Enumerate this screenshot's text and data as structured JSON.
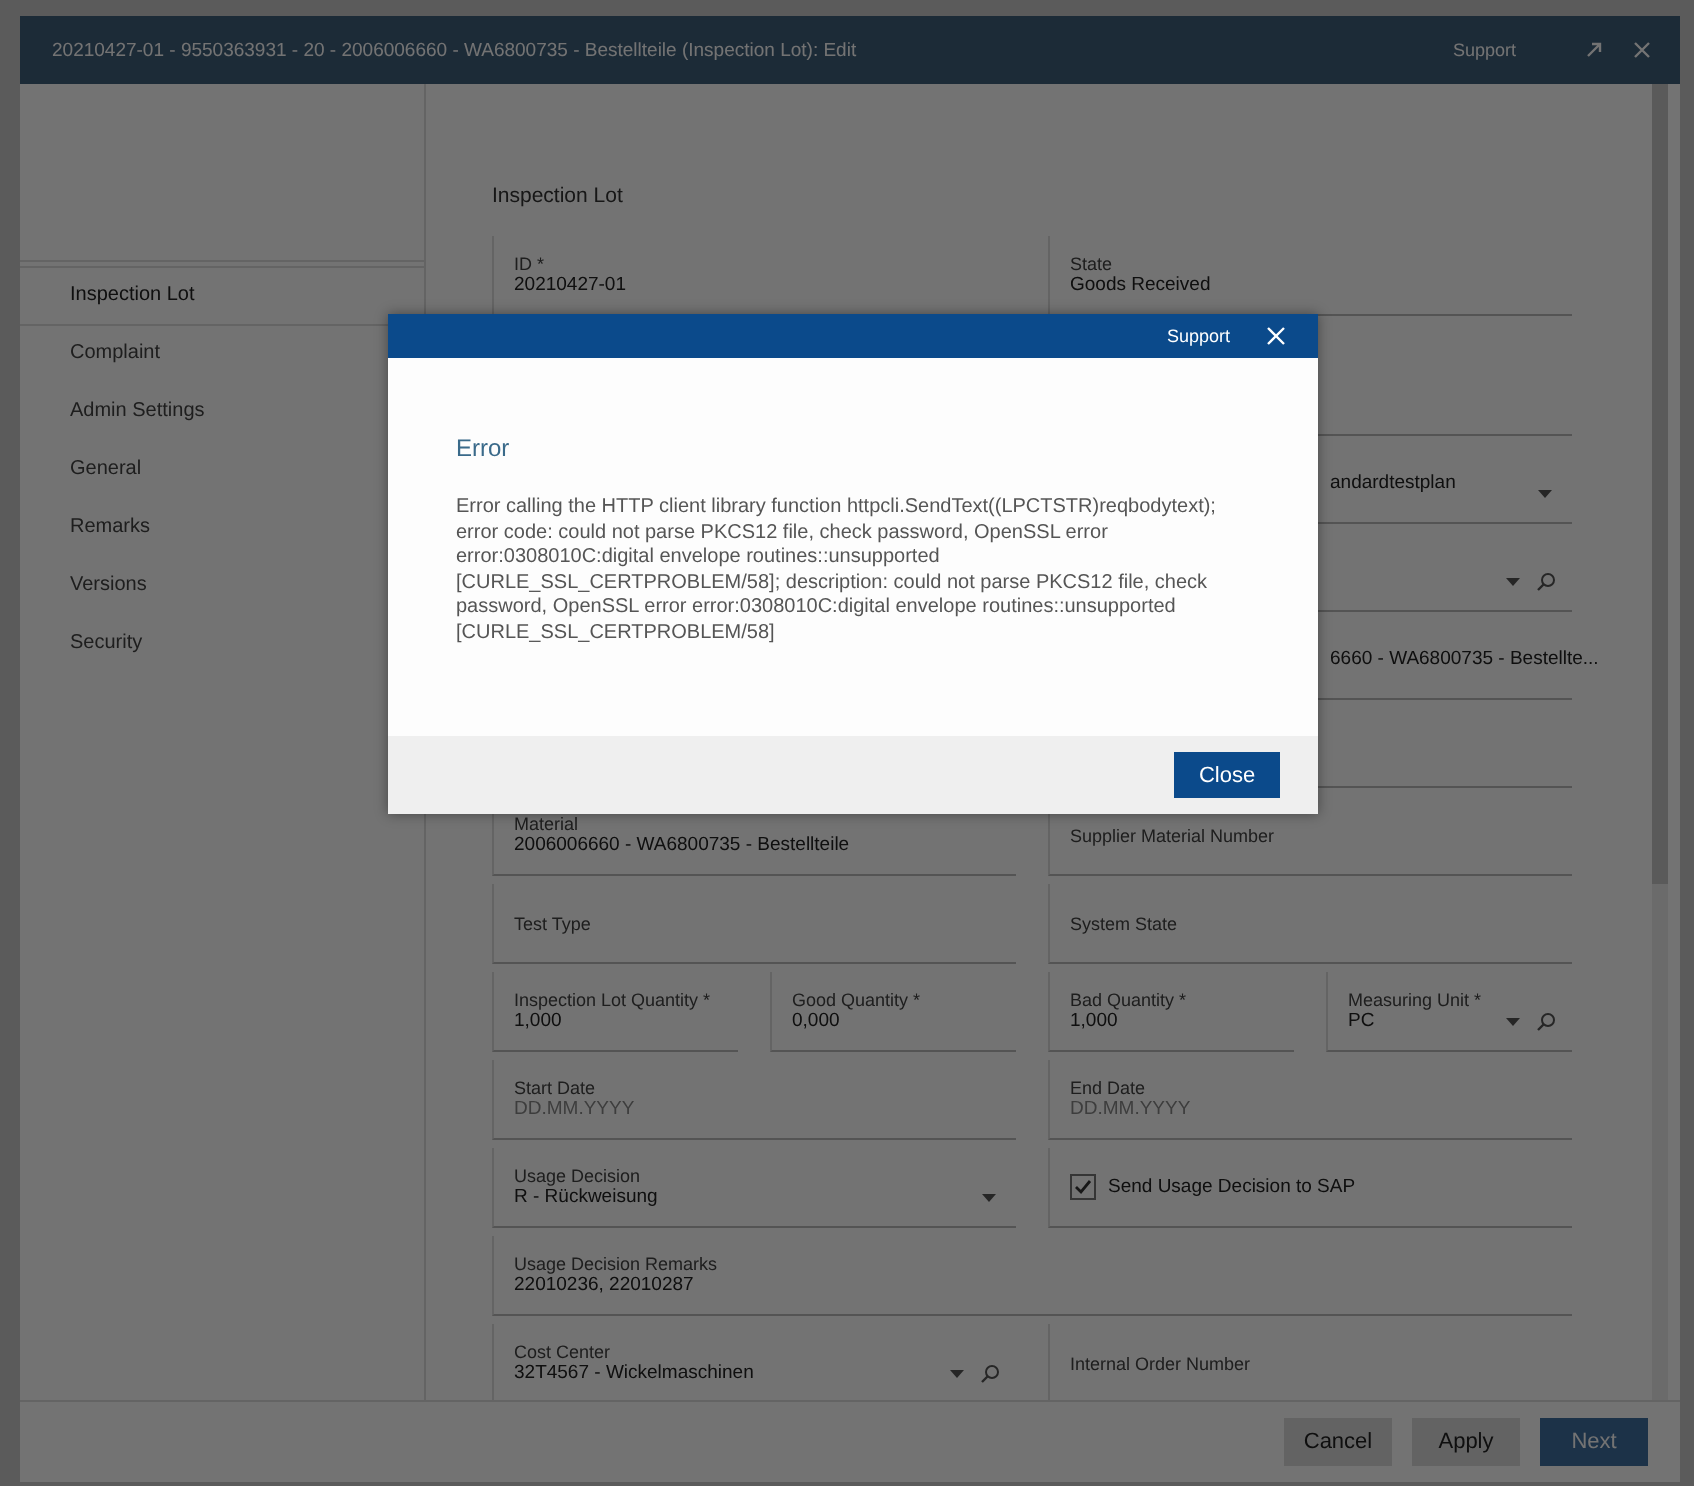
{
  "window": {
    "title": "20210427-01 - 9550363931 - 20 - 2006006660 - WA6800735 - Bestellteile (Inspection Lot): Edit",
    "support": "Support"
  },
  "sidebar": {
    "items": [
      {
        "label": "Inspection Lot",
        "selected": true
      },
      {
        "label": "Complaint",
        "selected": false
      },
      {
        "label": "Admin Settings",
        "selected": false
      },
      {
        "label": "General",
        "selected": false
      },
      {
        "label": "Remarks",
        "selected": false
      },
      {
        "label": "Versions",
        "selected": false
      },
      {
        "label": "Security",
        "selected": false
      }
    ]
  },
  "section_title": "Inspection Lot",
  "form": {
    "rows": [
      {
        "kind": "pair",
        "fields": [
          {
            "kind": "text",
            "label": "ID *",
            "value": "20210427-01"
          },
          {
            "kind": "text",
            "label": "State",
            "value": "Goods Received"
          }
        ]
      },
      {
        "kind": "right_only",
        "fields": [
          {
            "kind": "text"
          }
        ]
      },
      {
        "kind": "right_only",
        "fields": [
          {
            "kind": "dropdown",
            "value": "andardtestplan",
            "covered": true
          }
        ]
      },
      {
        "kind": "right_only",
        "fields": [
          {
            "kind": "lookup"
          }
        ]
      },
      {
        "kind": "right_only",
        "fields": [
          {
            "kind": "text",
            "value": "6660 - WA6800735 - Bestellte...",
            "covered": true
          }
        ]
      },
      {
        "kind": "right_only",
        "fields": [
          {
            "kind": "text"
          }
        ]
      },
      {
        "kind": "pair",
        "fields": [
          {
            "kind": "text",
            "label": "Material",
            "value": "2006006660 - WA6800735 - Bestellteile"
          },
          {
            "kind": "text",
            "label": "Supplier Material Number"
          }
        ]
      },
      {
        "kind": "pair",
        "fields": [
          {
            "kind": "text",
            "label": "Test Type"
          },
          {
            "kind": "text",
            "label": "System State"
          }
        ]
      },
      {
        "kind": "quad",
        "fields": [
          {
            "kind": "text",
            "label": "Inspection Lot Quantity *",
            "value": "1,000"
          },
          {
            "kind": "text",
            "label": "Good Quantity *",
            "value": "0,000"
          },
          {
            "kind": "text",
            "label": "Bad Quantity *",
            "value": "1,000"
          },
          {
            "kind": "lookup",
            "label": "Measuring Unit *",
            "value": "PC"
          }
        ]
      },
      {
        "kind": "pair",
        "fields": [
          {
            "kind": "date",
            "label": "Start Date",
            "placeholder": "DD.MM.YYYY"
          },
          {
            "kind": "date",
            "label": "End Date",
            "placeholder": "DD.MM.YYYY"
          }
        ]
      },
      {
        "kind": "pair",
        "fields": [
          {
            "kind": "dropdown",
            "label": "Usage Decision",
            "value": "R - Rückweisung"
          },
          {
            "kind": "checkbox",
            "label": "Send Usage Decision to SAP",
            "checked": true
          }
        ]
      },
      {
        "kind": "full",
        "fields": [
          {
            "kind": "text",
            "label": "Usage Decision Remarks",
            "value": "22010236, 22010287"
          }
        ]
      },
      {
        "kind": "pair",
        "fields": [
          {
            "kind": "lookup",
            "label": "Cost Center",
            "value": "32T4567 - Wickelmaschinen"
          },
          {
            "kind": "text",
            "label": "Internal Order Number"
          }
        ]
      }
    ]
  },
  "footer": {
    "buttons": [
      {
        "label": "Cancel",
        "kind": "secondary"
      },
      {
        "label": "Apply",
        "kind": "secondary"
      },
      {
        "label": "Next",
        "kind": "primary"
      }
    ]
  },
  "dialog": {
    "source": "Support",
    "heading": "Error",
    "message": "Error calling the HTTP client library function httpcli.SendText((LPCTSTR)reqbodytext); error code: could not parse PKCS12 file, check password, OpenSSL error error:0308010C:digital envelope routines::unsupported [CURLE_SSL_CERTPROBLEM/58]; description: could not parse PKCS12 file, check password, OpenSSL error error:0308010C:digital envelope routines::unsupported [CURLE_SSL_CERTPROBLEM/58]",
    "button": "Close"
  }
}
